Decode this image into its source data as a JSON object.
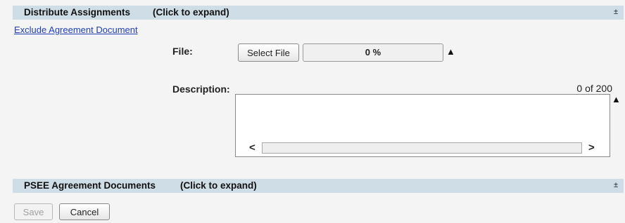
{
  "sections": [
    {
      "title": "Distribute Assignments",
      "hint": "(Click to expand)",
      "icon": "expand-icon"
    },
    {
      "title": "PSEE Agreement Documents",
      "hint": "(Click to expand)",
      "icon": "expand-icon"
    }
  ],
  "exclude_link": "Exclude Agreement Document",
  "file": {
    "label": "File:",
    "select_button": "Select File",
    "progress_text": "0 %",
    "progress_value": 0
  },
  "description": {
    "label": "Description:",
    "counter": "0 of 200",
    "value": ""
  },
  "icons": {
    "warning": "warning-icon",
    "scroll_left": "chevron-left-icon",
    "scroll_right": "chevron-right-icon"
  },
  "actions": {
    "save": "Save",
    "cancel": "Cancel"
  }
}
